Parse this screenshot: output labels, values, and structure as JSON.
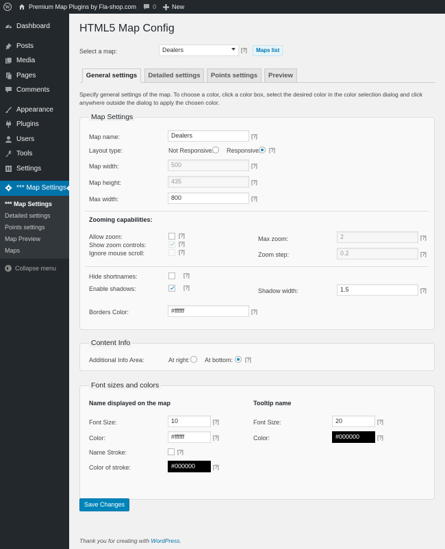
{
  "adminbar": {
    "site_name": "Premium Map Plugins by Fla-shop.com",
    "comments_count": "0",
    "new_label": "New"
  },
  "sidebar": {
    "items": [
      {
        "label": "Dashboard"
      },
      {
        "label": "Posts"
      },
      {
        "label": "Media"
      },
      {
        "label": "Pages"
      },
      {
        "label": "Comments"
      },
      {
        "label": "Appearance"
      },
      {
        "label": "Plugins"
      },
      {
        "label": "Users"
      },
      {
        "label": "Tools"
      },
      {
        "label": "Settings"
      },
      {
        "label": "*** Map Settings"
      }
    ],
    "submenu": [
      "*** Map Settings",
      "Detailed settings",
      "Points settings",
      "Map Preview",
      "Maps"
    ],
    "collapse_label": "Collapse menu"
  },
  "page": {
    "title": "HTML5 Map Config",
    "select_map_label": "Select a map:",
    "select_map_value": "Dealers",
    "help": "[?]",
    "maps_list_button": "Maps list",
    "tabs": [
      "General settings",
      "Detailed settings",
      "Points settings",
      "Preview"
    ],
    "description": "Specify general settings of the map. To choose a color, click a color box, select the desired color in the color selection dialog and click anywhere outside the dialog to apply the chosen color."
  },
  "map_settings": {
    "legend": "Map Settings",
    "map_name_label": "Map name:",
    "map_name_value": "Dealers",
    "layout_type_label": "Layout type:",
    "not_responsive_label": "Not Responsive:",
    "responsive_label": "Responsive:",
    "map_width_label": "Map width:",
    "map_width_value": "500",
    "map_height_label": "Map height:",
    "map_height_value": "435",
    "max_width_label": "Max width:",
    "max_width_value": "800",
    "zooming_heading": "Zooming capabilities:",
    "allow_zoom_label": "Allow zoom:",
    "show_zoom_label": "Show zoom controls:",
    "ignore_scroll_label": "Ignore mouse scroll:",
    "max_zoom_label": "Max zoom:",
    "max_zoom_value": "2",
    "zoom_step_label": "Zoom step:",
    "zoom_step_value": "0.2",
    "hide_shortnames_label": "Hide shortnames:",
    "enable_shadows_label": "Enable shadows:",
    "shadow_width_label": "Shadow width:",
    "shadow_width_value": "1.5",
    "borders_color_label": "Borders Color:",
    "borders_color_value": "#ffffff"
  },
  "content_info": {
    "legend": "Content Info",
    "additional_label": "Additional Info Area:",
    "at_right_label": "At right:",
    "at_bottom_label": "At bottom:"
  },
  "fonts": {
    "legend": "Font sizes and colors",
    "name_heading": "Name displayed on the map",
    "tooltip_heading": "Tooltip name",
    "font_size_label": "Font Size:",
    "name_font_size": "10",
    "tooltip_font_size": "20",
    "color_label": "Color:",
    "name_color": "#ffffff",
    "tooltip_color": "#000000",
    "name_stroke_label": "Name Stroke:",
    "stroke_color_label": "Color of stroke:",
    "stroke_color_value": "#000000"
  },
  "save_label": "Save Changes",
  "footer": {
    "text": "Thank you for creating with ",
    "link": "WordPress",
    "end": "."
  }
}
